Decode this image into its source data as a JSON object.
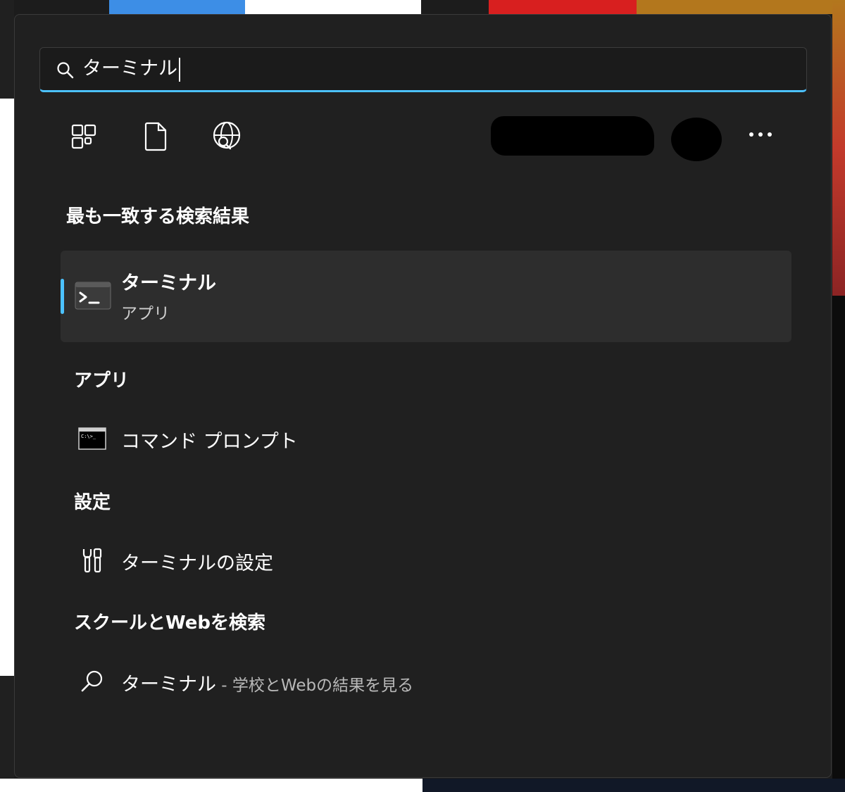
{
  "search": {
    "query": "ターミナル"
  },
  "filters": {
    "apps_icon": "apps-grid-icon",
    "documents_icon": "document-icon",
    "web_icon": "web-search-icon",
    "more_icon": "more-options-icon"
  },
  "best_match": {
    "heading": "最も一致する検索結果",
    "title": "ターミナル",
    "subtitle": "アプリ",
    "icon": "terminal-app-icon"
  },
  "apps": {
    "heading": "アプリ",
    "items": [
      {
        "label": "コマンド プロンプト",
        "icon": "command-prompt-icon"
      }
    ]
  },
  "settings": {
    "heading": "設定",
    "items": [
      {
        "label": "ターミナルの設定",
        "icon": "settings-tools-icon"
      }
    ]
  },
  "web": {
    "heading": "スクールとWebを検索",
    "items": [
      {
        "label": "ターミナル",
        "suffix": " - 学校とWebの結果を見る",
        "icon": "search-icon"
      }
    ]
  },
  "colors": {
    "accent": "#4cc2ff",
    "panel_bg": "#202020",
    "card_bg": "#2d2d2d"
  }
}
